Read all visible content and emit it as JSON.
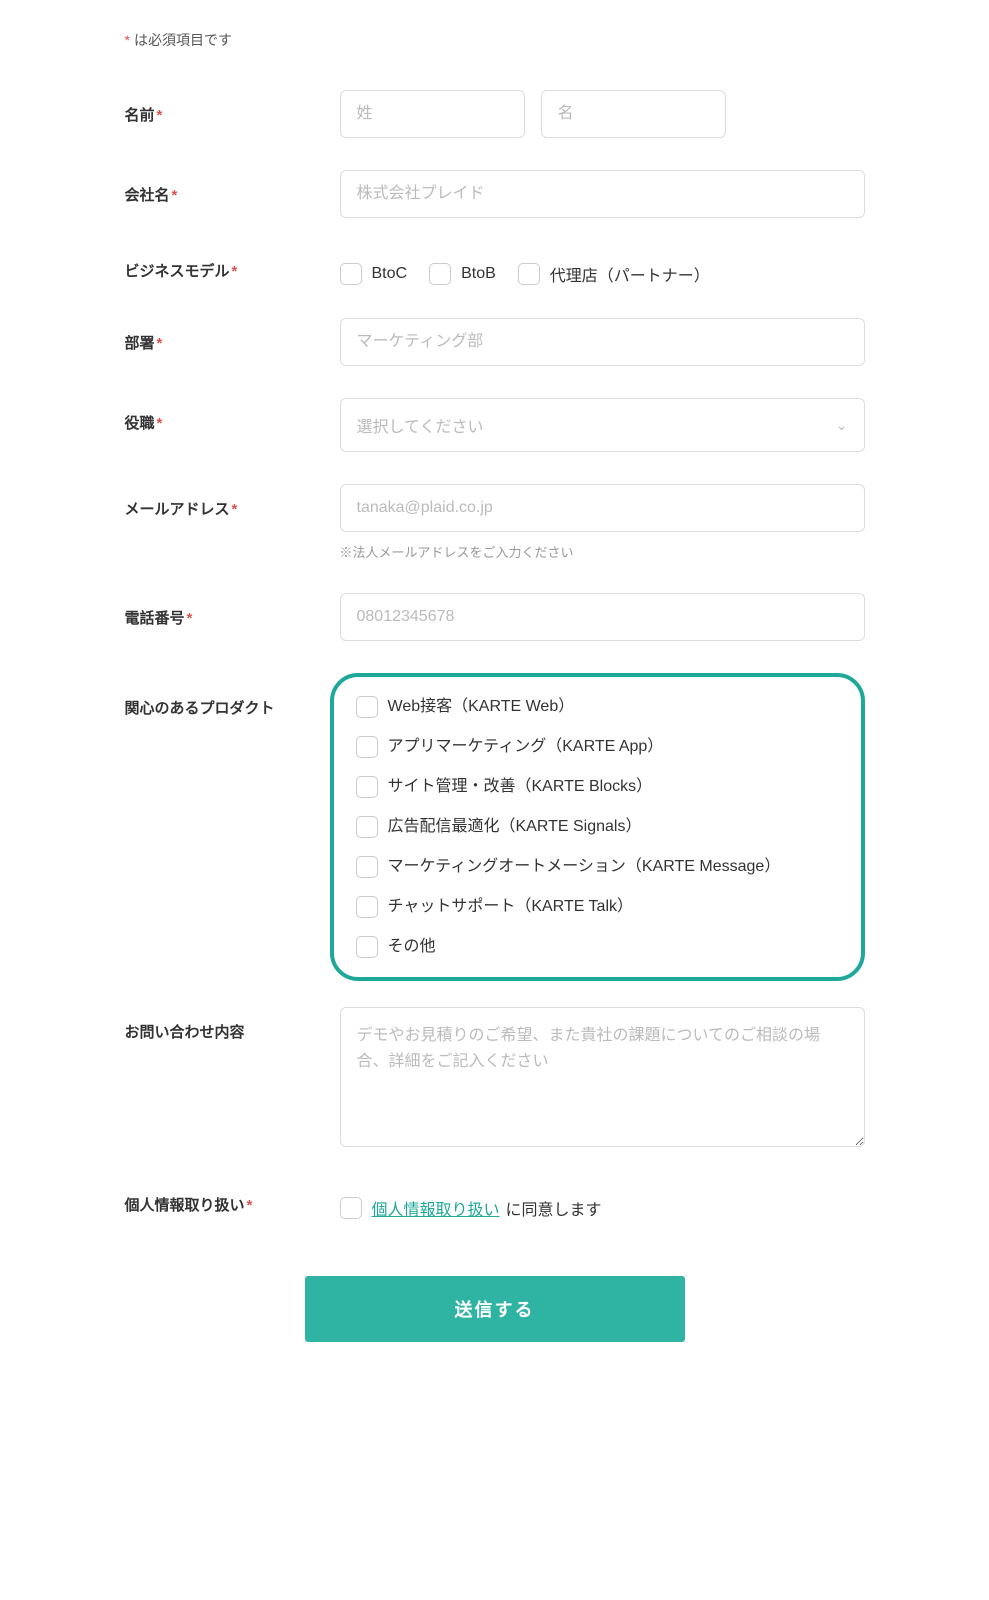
{
  "required_note": "は必須項目です",
  "labels": {
    "name": "名前",
    "company": "会社名",
    "business_model": "ビジネスモデル",
    "department": "部署",
    "position": "役職",
    "email": "メールアドレス",
    "phone": "電話番号",
    "products": "関心のあるプロダクト",
    "inquiry": "お問い合わせ内容",
    "privacy": "個人情報取り扱い"
  },
  "placeholders": {
    "last_name": "姓",
    "first_name": "名",
    "company": "株式会社プレイド",
    "department": "マーケティング部",
    "position": "選択してください",
    "email": "tanaka@plaid.co.jp",
    "phone": "08012345678",
    "inquiry": "デモやお見積りのご希望、また貴社の課題についてのご相談の場合、詳細をご記入ください"
  },
  "helper": {
    "email": "※法人メールアドレスをご入力ください"
  },
  "business_model_options": [
    "BtoC",
    "BtoB",
    "代理店（パートナー）"
  ],
  "product_options": [
    "Web接客（KARTE Web）",
    "アプリマーケティング（KARTE App）",
    "サイト管理・改善（KARTE Blocks）",
    "広告配信最適化（KARTE Signals）",
    "マーケティングオートメーション（KARTE Message）",
    "チャットサポート（KARTE Talk）",
    "その他"
  ],
  "privacy": {
    "link_text": "個人情報取り扱い",
    "agree_suffix": "に同意します"
  },
  "submit_label": "送信する"
}
